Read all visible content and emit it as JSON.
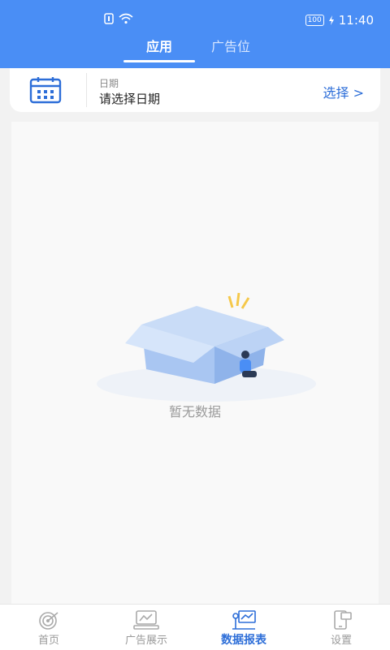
{
  "status_bar": {
    "battery": "100",
    "time": "11:40"
  },
  "tabs": [
    {
      "label": "应用",
      "active": true
    },
    {
      "label": "广告位",
      "active": false
    }
  ],
  "date_filter": {
    "label": "日期",
    "placeholder": "请选择日期",
    "action": "选择 >"
  },
  "empty_state": {
    "message": "暂无数据"
  },
  "bottom_nav": [
    {
      "label": "首页",
      "icon": "home-radar-icon",
      "active": false
    },
    {
      "label": "广告展示",
      "icon": "ad-display-icon",
      "active": false
    },
    {
      "label": "数据报表",
      "icon": "data-report-icon",
      "active": true
    },
    {
      "label": "设置",
      "icon": "settings-phone-icon",
      "active": false
    }
  ],
  "colors": {
    "primary": "#4a8ef5",
    "accent": "#2d6ed8",
    "muted": "#9a9a9a"
  }
}
